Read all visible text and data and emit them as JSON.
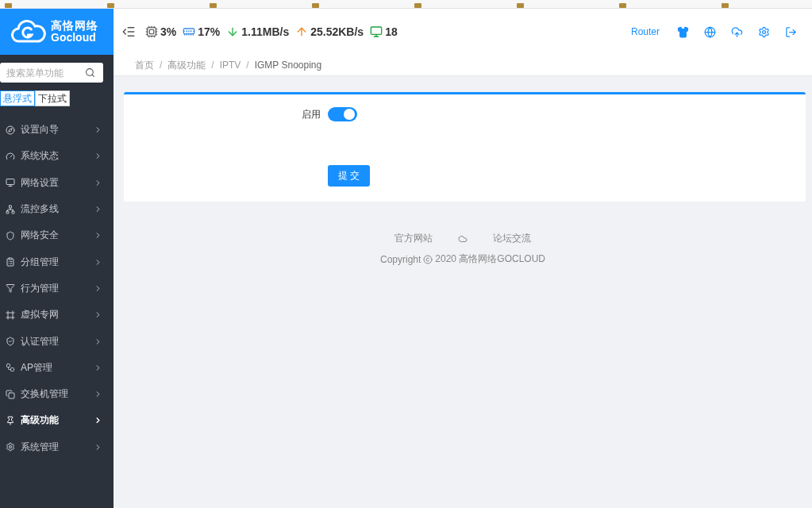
{
  "logo": {
    "name_cn": "高恪网络",
    "name_en": "Gocloud"
  },
  "header": {
    "stats": [
      {
        "kind": "cpu",
        "value": "3%"
      },
      {
        "kind": "memory",
        "value": "17%"
      },
      {
        "kind": "download",
        "value": "1.11MB/s"
      },
      {
        "kind": "upload",
        "value": "25.52KB/s"
      },
      {
        "kind": "clients",
        "value": "18"
      }
    ],
    "mode_label": "Router"
  },
  "sidebar": {
    "search": {
      "placeholder": "搜索菜单功能"
    },
    "layout_tabs": [
      {
        "label": "悬浮式",
        "selected": true
      },
      {
        "label": "下拉式",
        "selected": false
      }
    ],
    "items": [
      {
        "label": "设置向导",
        "selected": false
      },
      {
        "label": "系统状态",
        "selected": false
      },
      {
        "label": "网络设置",
        "selected": false
      },
      {
        "label": "流控多线",
        "selected": false
      },
      {
        "label": "网络安全",
        "selected": false
      },
      {
        "label": "分组管理",
        "selected": false
      },
      {
        "label": "行为管理",
        "selected": false
      },
      {
        "label": "虚拟专网",
        "selected": false
      },
      {
        "label": "认证管理",
        "selected": false
      },
      {
        "label": "AP管理",
        "selected": false
      },
      {
        "label": "交换机管理",
        "selected": false
      },
      {
        "label": "高级功能",
        "selected": true
      },
      {
        "label": "系统管理",
        "selected": false
      }
    ]
  },
  "breadcrumb": {
    "separator": "/",
    "items": [
      "首页",
      "高级功能",
      "IPTV",
      "IGMP Snooping"
    ]
  },
  "form": {
    "enable_label": "启用",
    "enabled": true,
    "submit": "提 交"
  },
  "footer": {
    "links": [
      "官方网站",
      "论坛交流"
    ],
    "copyright": "Copyright",
    "copyright_rest": "2020 高恪网络GOCLOUD"
  }
}
